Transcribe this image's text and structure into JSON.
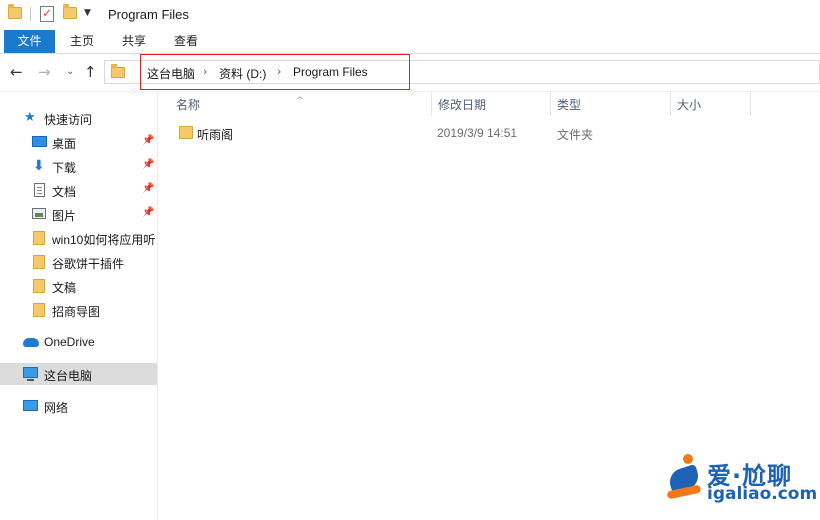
{
  "window": {
    "title": "Program Files"
  },
  "ribbon": {
    "tabs": [
      {
        "label": "文件"
      },
      {
        "label": "主页"
      },
      {
        "label": "共享"
      },
      {
        "label": "查看"
      }
    ]
  },
  "address": {
    "breadcrumbs": [
      {
        "label": "这台电脑"
      },
      {
        "label": "资料 (D:)"
      },
      {
        "label": "Program Files"
      }
    ]
  },
  "sidebar": {
    "quick_access": "快速访问",
    "items": [
      {
        "label": "桌面",
        "icon": "desktop-icon",
        "pinned": true
      },
      {
        "label": "下载",
        "icon": "download-icon",
        "pinned": true
      },
      {
        "label": "文档",
        "icon": "document-icon",
        "pinned": true
      },
      {
        "label": "图片",
        "icon": "picture-icon",
        "pinned": true
      },
      {
        "label": "win10如何将应用听",
        "icon": "folder-icon",
        "pinned": false
      },
      {
        "label": "谷歌饼干插件",
        "icon": "folder-icon",
        "pinned": false
      },
      {
        "label": "文稿",
        "icon": "folder-icon",
        "pinned": false
      },
      {
        "label": "招商导图",
        "icon": "folder-icon",
        "pinned": false
      }
    ],
    "onedrive": "OneDrive",
    "this_pc": "这台电脑",
    "network": "网络"
  },
  "columns": {
    "name": "名称",
    "modified": "修改日期",
    "type": "类型",
    "size": "大小"
  },
  "files": [
    {
      "name": "听雨阁",
      "modified": "2019/3/9 14:51",
      "type": "文件夹",
      "size": ""
    }
  ],
  "watermark": {
    "title": "爱·尬聊",
    "url": "igaliao.com"
  },
  "colors": {
    "accent": "#1979ca",
    "selection": "#dcdcdc",
    "highlight_box": "#e02020",
    "header_text": "#4c607a"
  }
}
